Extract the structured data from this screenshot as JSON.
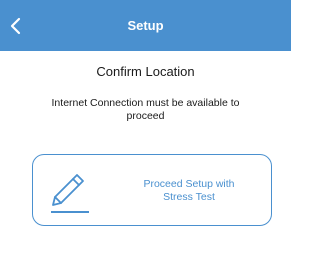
{
  "app_bar": {
    "title": "Setup",
    "back_icon": "chevron-left-icon",
    "background_color": "#4a90cf"
  },
  "main": {
    "heading": "Confirm Location",
    "note": "Internet Connection must be available to proceed"
  },
  "action_card": {
    "icon": "pencil-edit-icon",
    "label_line1": "Proceed Setup with",
    "label_line2": "Stress Test",
    "accent_color": "#4a90cf"
  }
}
